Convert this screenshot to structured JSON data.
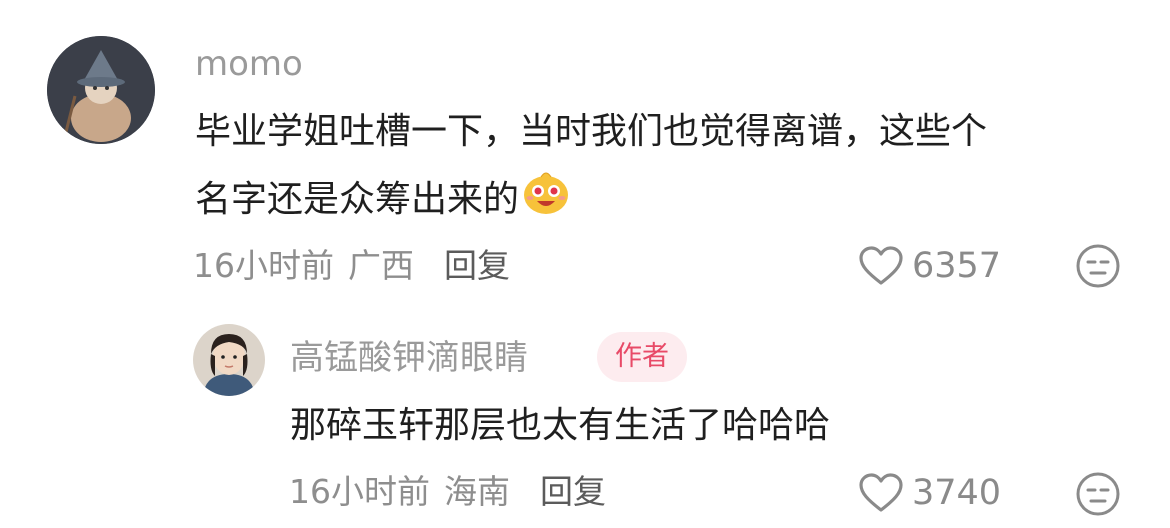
{
  "comment": {
    "username": "momo",
    "line1": "毕业学姐吐槽一下，当时我们也觉得离谱，这些个",
    "line2": "名字还是众筹出来的",
    "emoji_icon": "smiling-face-with-sparkle-eyes-emoji",
    "time": "16小时前",
    "location": "广西",
    "reply_label": "回复",
    "like_count": "6357"
  },
  "reply": {
    "username": "高锰酸钾滴眼睛",
    "badge": "作者",
    "text": "那碎玉轩那层也太有生活了哈哈哈",
    "time": "16小时前",
    "location": "海南",
    "reply_label": "回复",
    "like_count": "3740"
  },
  "colors": {
    "accent_badge_text": "#e84a67",
    "accent_badge_bg": "#fdecef",
    "muted_text": "#9a9a9a"
  }
}
